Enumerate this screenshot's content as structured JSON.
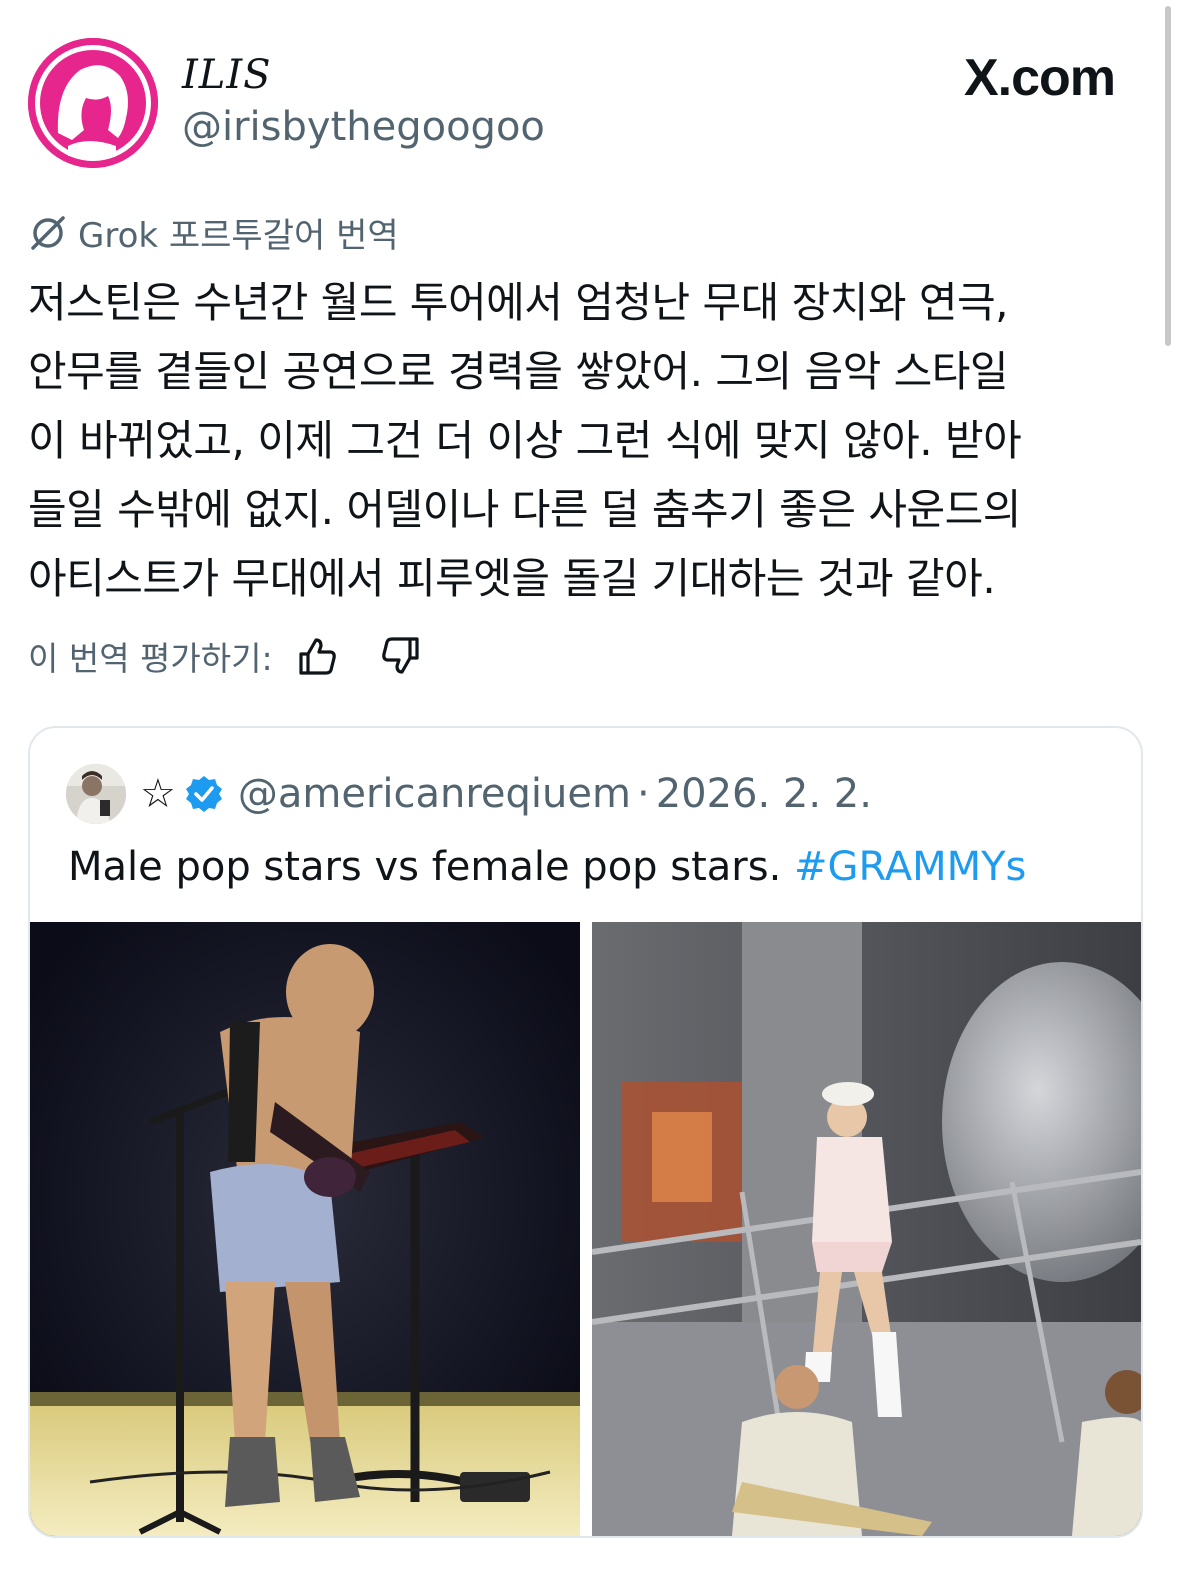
{
  "author": {
    "display_name": "ILIS",
    "handle": "@irisbythegoogoo",
    "avatar_icon": "pink-portrait-avatar"
  },
  "watermark": "X.com",
  "translation": {
    "label": "Grok 포르투갈어 번역",
    "icon": "grok-icon",
    "text": "저스틴은 수년간 월드 투어에서 엄청난 무대 장치와 연극,\n안무를 곁들인 공연으로 경력을 쌓았어. 그의 음악 스타일\n이 바뀌었고, 이제 그건 더 이상 그런 식에 맞지 않아. 받아\n들일 수밖에 없지. 어델이나 다른 덜 춤추기 좋은 사운드의\n아티스트가 무대에서 피루엣을 돌길 기대하는 것과 같아.",
    "rate_label": "이 번역 평가하기:"
  },
  "quoted_tweet": {
    "name": "☆",
    "verified": true,
    "handle": "@americanreqiuem",
    "separator": "·",
    "date": "2026. 2. 2.",
    "text": "Male pop stars vs female pop stars.",
    "hashtag": "#GRAMMYs",
    "media": [
      "male-performer-photo",
      "female-performer-photo"
    ]
  },
  "colors": {
    "accent": "#1d9bf0",
    "secondary_text": "#536471",
    "avatar_pink": "#e6268c"
  }
}
